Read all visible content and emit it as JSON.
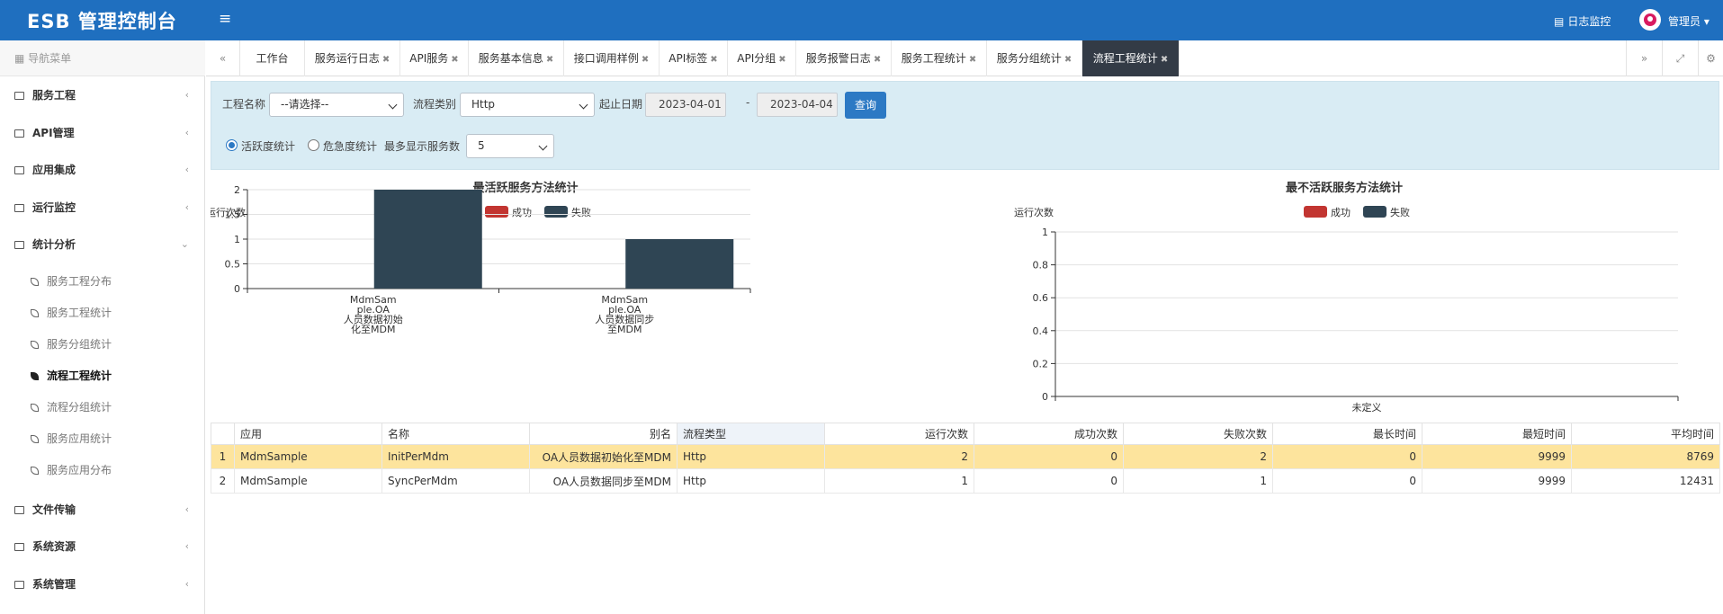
{
  "header": {
    "brand": "ESB 管理控制台",
    "log_monitor": "日志监控",
    "user": "管理员",
    "accent": "#1f6fbf"
  },
  "sidebar": {
    "title": "导航菜单",
    "groups": [
      {
        "label": "服务工程"
      },
      {
        "label": "API管理"
      },
      {
        "label": "应用集成"
      },
      {
        "label": "运行监控"
      },
      {
        "label": "统计分析"
      },
      {
        "label": "文件传输"
      },
      {
        "label": "系统资源"
      },
      {
        "label": "系统管理"
      }
    ],
    "sub_items": [
      {
        "label": "服务工程分布"
      },
      {
        "label": "服务工程统计"
      },
      {
        "label": "服务分组统计"
      },
      {
        "label": "流程工程统计"
      },
      {
        "label": "流程分组统计"
      },
      {
        "label": "服务应用统计"
      },
      {
        "label": "服务应用分布"
      }
    ]
  },
  "tabs": [
    {
      "label": "工作台"
    },
    {
      "label": "服务运行日志"
    },
    {
      "label": "API服务"
    },
    {
      "label": "服务基本信息"
    },
    {
      "label": "接口调用样例"
    },
    {
      "label": "API标签"
    },
    {
      "label": "API分组"
    },
    {
      "label": "服务报警日志"
    },
    {
      "label": "服务工程统计"
    },
    {
      "label": "服务分组统计"
    },
    {
      "label": "流程工程统计"
    }
  ],
  "filter": {
    "project_label": "工程名称",
    "project_value": "--请选择--",
    "flow_type_label": "流程类别",
    "flow_type_value": "Http",
    "date_label": "起止日期",
    "start_date": "2023-04-01",
    "date_sep": "-",
    "end_date": "2023-04-04",
    "query_label": "查询",
    "radio_active": "活跃度统计",
    "radio_risk": "危急度统计",
    "max_label": "最多显示服务数",
    "max_value": "5"
  },
  "chart_data": [
    {
      "type": "bar",
      "title": "最活跃服务方法统计",
      "ylabel": "运行次数",
      "categories": [
        "MdmSample.OA人员数据初始化至MDM",
        "MdmSample.OA人员数据同步至MDM"
      ],
      "category_lines": [
        [
          "MdmSam",
          "ple.OA",
          "人员数据初始",
          "化至MDM"
        ],
        [
          "MdmSam",
          "ple.OA",
          "人员数据同步",
          "至MDM"
        ]
      ],
      "series": [
        {
          "name": "成功",
          "color": "#c23531",
          "values": [
            0,
            0
          ]
        },
        {
          "name": "失败",
          "color": "#2f4554",
          "values": [
            2,
            1
          ]
        }
      ],
      "ylim": [
        0,
        2
      ],
      "yticks": [
        "0",
        "0.5",
        "1",
        "1.5",
        "2"
      ],
      "legend": "top"
    },
    {
      "type": "bar",
      "title": "最不活跃服务方法统计",
      "ylabel": "运行次数",
      "categories": [
        "未定义"
      ],
      "series": [
        {
          "name": "成功",
          "color": "#c23531",
          "values": []
        },
        {
          "name": "失败",
          "color": "#2f4554",
          "values": []
        }
      ],
      "ylim": [
        0,
        1
      ],
      "yticks": [
        "0",
        "0.2",
        "0.4",
        "0.6",
        "0.8",
        "1"
      ],
      "legend": "top"
    }
  ],
  "table": {
    "columns": [
      "应用",
      "名称",
      "别名",
      "流程类型",
      "运行次数",
      "成功次数",
      "失败次数",
      "最长时间",
      "最短时间",
      "平均时间"
    ],
    "rows": [
      {
        "no": "1",
        "cells": [
          "MdmSample",
          "InitPerMdm",
          "OA人员数据初始化至MDM",
          "Http",
          "2",
          "0",
          "2",
          "0",
          "9999",
          "8769"
        ]
      },
      {
        "no": "2",
        "cells": [
          "MdmSample",
          "SyncPerMdm",
          "OA人员数据同步至MDM",
          "Http",
          "1",
          "0",
          "1",
          "0",
          "9999",
          "12431"
        ]
      }
    ]
  }
}
